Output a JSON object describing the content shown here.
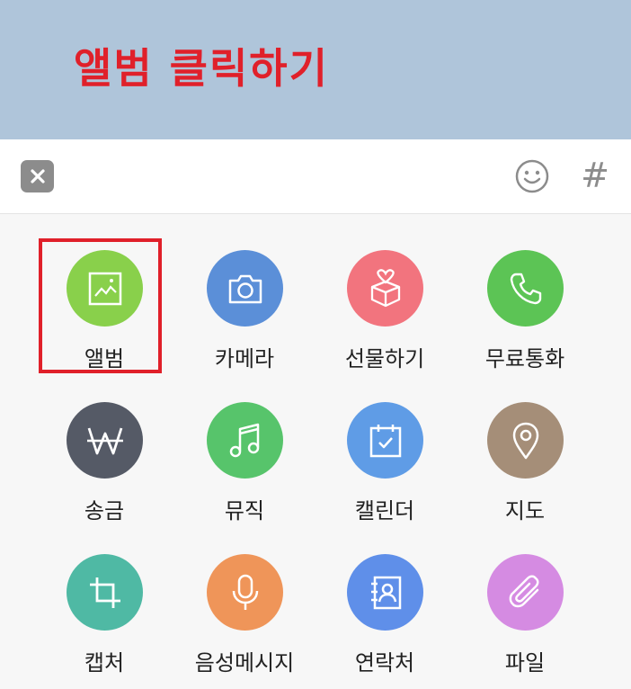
{
  "banner": {
    "title": "앨범 클릭하기"
  },
  "toolbar": {
    "close_icon": "close-icon",
    "emoji_icon": "smiley-icon",
    "hash_label": "#"
  },
  "colors": {
    "banner_bg": "#afc5da",
    "highlight": "#e0202a",
    "album": "#89d04b",
    "camera": "#5b8fd8",
    "gift": "#f2747e",
    "call": "#5cc455",
    "transfer": "#555a66",
    "music": "#57c46b",
    "calendar": "#5f9ce6",
    "map": "#a58e78",
    "capture": "#4fb9a4",
    "voice": "#ef9559",
    "contact": "#5f8fe9",
    "file": "#d58be2"
  },
  "menu": {
    "items": [
      {
        "label": "앨범",
        "icon": "image-icon"
      },
      {
        "label": "카메라",
        "icon": "camera-icon"
      },
      {
        "label": "선물하기",
        "icon": "gift-icon"
      },
      {
        "label": "무료통화",
        "icon": "phone-icon"
      },
      {
        "label": "송금",
        "icon": "won-icon"
      },
      {
        "label": "뮤직",
        "icon": "music-icon"
      },
      {
        "label": "캘린더",
        "icon": "calendar-icon"
      },
      {
        "label": "지도",
        "icon": "map-pin-icon"
      },
      {
        "label": "캡처",
        "icon": "crop-icon"
      },
      {
        "label": "음성메시지",
        "icon": "microphone-icon"
      },
      {
        "label": "연락처",
        "icon": "contact-icon"
      },
      {
        "label": "파일",
        "icon": "paperclip-icon"
      }
    ]
  }
}
